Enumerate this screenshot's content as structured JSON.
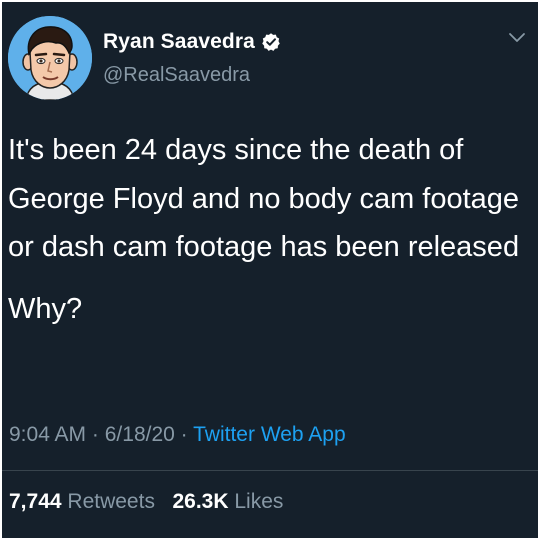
{
  "author": {
    "display_name": "Ryan Saavedra",
    "handle": "@RealSaavedra",
    "verified": true
  },
  "icons": {
    "avatar": "cartoon-portrait-avatar",
    "verified": "verified-badge-icon",
    "menu": "chevron-down-icon"
  },
  "tweet": {
    "text_paragraphs": [
      "It's been 24 days since the death of George Floyd and no body cam footage or dash cam footage has been released",
      "Why?"
    ],
    "time": "9:04 AM",
    "separator": "·",
    "date": "6/18/20",
    "source": "Twitter Web App"
  },
  "stats": {
    "retweets_count": "7,744",
    "retweets_label": "Retweets",
    "likes_count": "26.3K",
    "likes_label": "Likes"
  },
  "colors": {
    "background": "#15202b",
    "secondary_text": "#8899a6",
    "accent": "#1da1f2",
    "divider": "#38444d"
  }
}
